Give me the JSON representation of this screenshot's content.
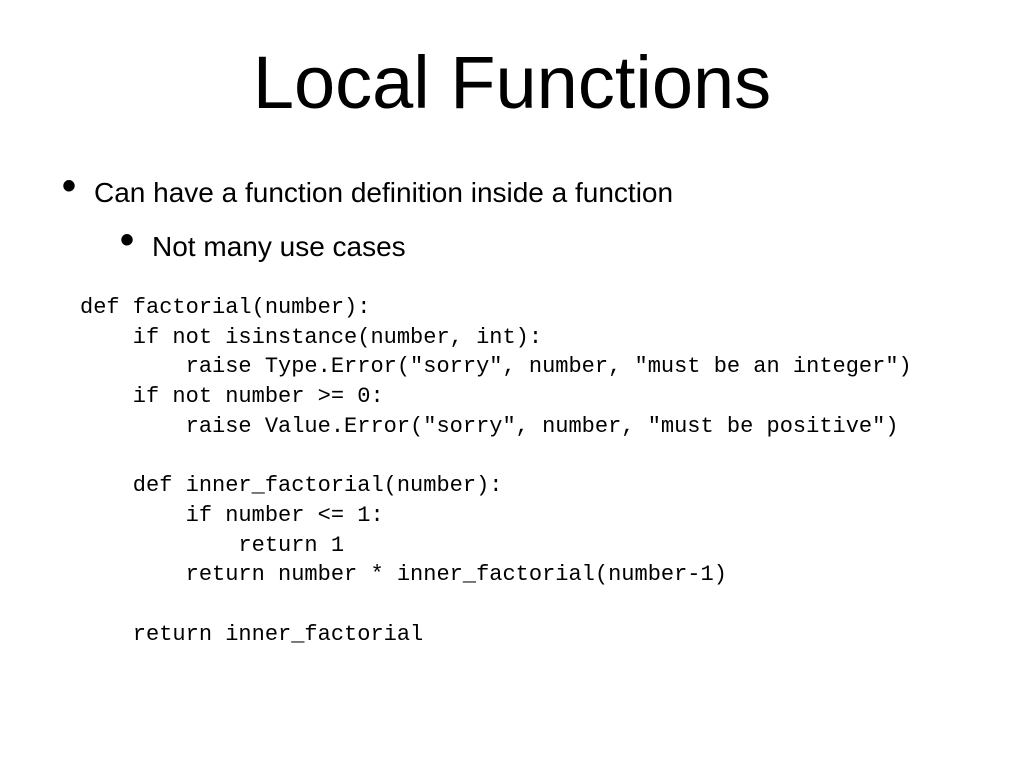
{
  "title": "Local Functions",
  "bullets": {
    "item1": "Can have a function definition inside a function",
    "item2": "Not many use cases"
  },
  "code": "def factorial(number):\n    if not isinstance(number, int):\n        raise Type.Error(\"sorry\", number, \"must be an integer\")\n    if not number >= 0:\n        raise Value.Error(\"sorry\", number, \"must be positive\")\n\n    def inner_factorial(number):\n        if number <= 1:\n            return 1\n        return number * inner_factorial(number-1)\n\n    return inner_factorial"
}
